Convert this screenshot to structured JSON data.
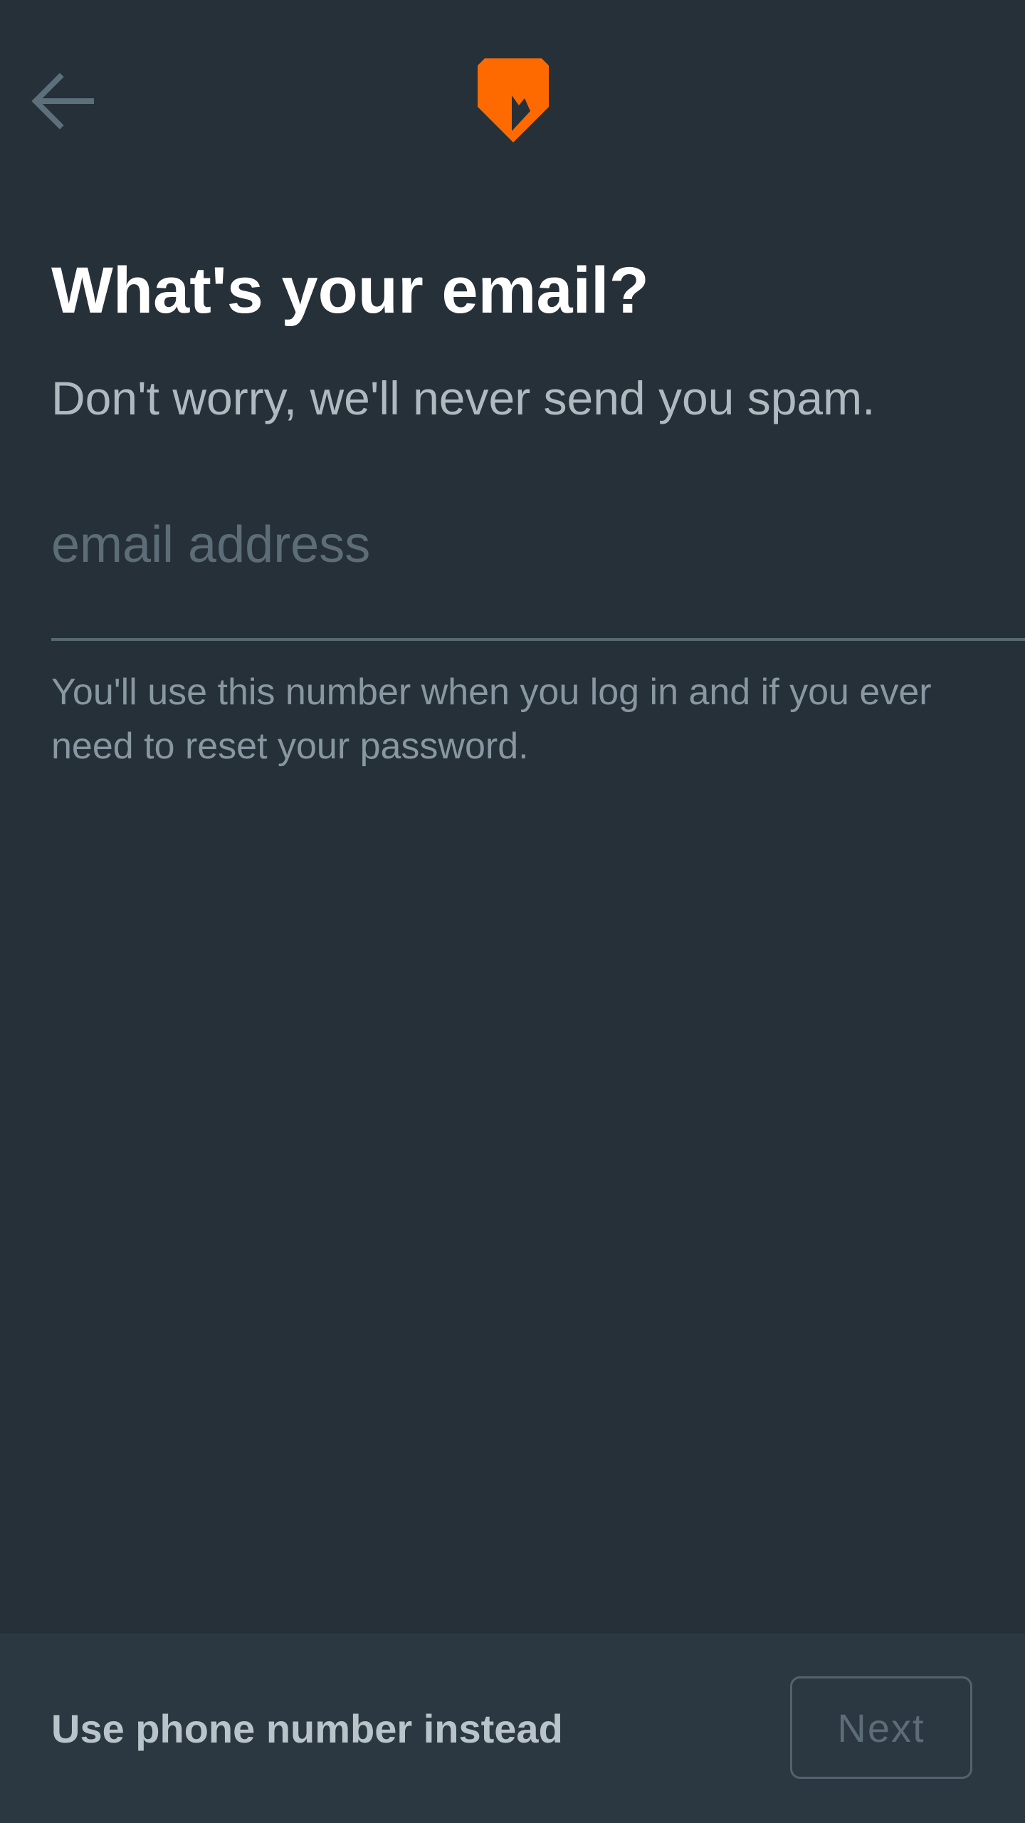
{
  "header": {
    "back_icon": "arrow-left-icon",
    "logo_icon": "orange-shield-logo-icon"
  },
  "content": {
    "title": "What's your email?",
    "subtitle": "Don't worry, we'll never send you spam.",
    "email": {
      "value": "",
      "placeholder": "email address"
    },
    "helper_text": "You'll use this number when you log in and if you ever need to reset your password."
  },
  "footer": {
    "alt_link_label": "Use phone number instead",
    "next_label": "Next"
  },
  "colors": {
    "background": "#263038",
    "footer_background": "#2c3841",
    "accent": "#ff6a00",
    "title": "#ffffff",
    "subtitle": "#aeb9c0",
    "muted": "#5d6d77"
  }
}
